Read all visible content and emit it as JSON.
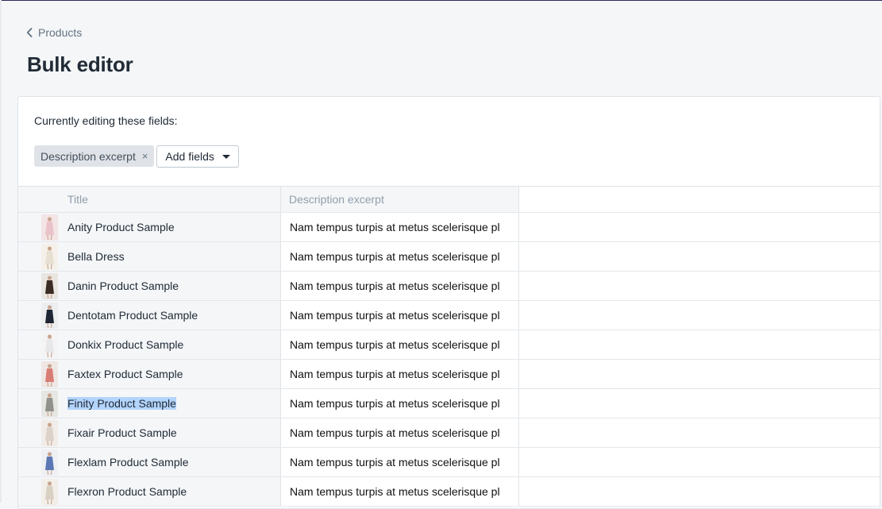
{
  "breadcrumb": {
    "label": "Products"
  },
  "page": {
    "title": "Bulk editor"
  },
  "editor": {
    "label": "Currently editing these fields:",
    "chips": [
      {
        "label": "Description excerpt",
        "remove_glyph": "×"
      }
    ],
    "add_fields_label": "Add fields"
  },
  "table": {
    "headers": {
      "title": "Title",
      "description": "Description excerpt"
    },
    "rows": [
      {
        "title": "Anity Product Sample",
        "description": "Nam tempus turpis at metus scelerisque pl",
        "thumb_color": "#f3e4e6",
        "figure_color": "#e9c3c9"
      },
      {
        "title": "Bella Dress",
        "description": "Nam tempus turpis at metus scelerisque pl",
        "thumb_color": "#f5f1ea",
        "figure_color": "#e6dfd2"
      },
      {
        "title": "Danin Product Sample",
        "description": "Nam tempus turpis at metus scelerisque pl",
        "thumb_color": "#e9e6e2",
        "figure_color": "#3a2b24"
      },
      {
        "title": "Dentotam Product Sample",
        "description": "Nam tempus turpis at metus scelerisque pl",
        "thumb_color": "#eceeef",
        "figure_color": "#1e2533"
      },
      {
        "title": "Donkix Product Sample",
        "description": "Nam tempus turpis at metus scelerisque pl",
        "thumb_color": "#f4f4f4",
        "figure_color": "#e7e7ea"
      },
      {
        "title": "Faxtex Product Sample",
        "description": "Nam tempus turpis at metus scelerisque pl",
        "thumb_color": "#efe7e4",
        "figure_color": "#d97c74"
      },
      {
        "title": "Finity Product Sample",
        "description": "Nam tempus turpis at metus scelerisque pl",
        "thumb_color": "#e6e6e2",
        "figure_color": "#8f918a",
        "selected": true
      },
      {
        "title": "Fixair Product Sample",
        "description": "Nam tempus turpis at metus scelerisque pl",
        "thumb_color": "#f1ece8",
        "figure_color": "#dcd2ca"
      },
      {
        "title": "Flexlam Product Sample",
        "description": "Nam tempus turpis at metus scelerisque pl",
        "thumb_color": "#eef0f4",
        "figure_color": "#5b78b5"
      },
      {
        "title": "Flexron Product Sample",
        "description": "Nam tempus turpis at metus scelerisque pl",
        "thumb_color": "#f2efe9",
        "figure_color": "#d8d0c2"
      }
    ]
  },
  "colors": {
    "page_bg": "#f4f6f8",
    "card_bg": "#ffffff",
    "selection": "#b3d4fc",
    "muted_text": "#919eab"
  }
}
